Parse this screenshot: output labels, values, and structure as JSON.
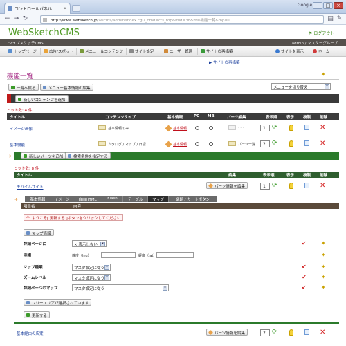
{
  "browser": {
    "tab_title": "コントロールパネル",
    "top_right_text": "Google",
    "url_prefix": "http://www.websketch.jp",
    "url_rest": "/wscms/admin/index.cgi?_cmd=cts_top&mid=38&m=機能一覧&mp=1"
  },
  "app": {
    "logo": "WebSketchCMS",
    "logout": "ログアウト",
    "site_name": "ウェブスケッチCMS",
    "user": "admin / マスターグループ"
  },
  "menu": {
    "items": [
      "トップページ",
      "広告/スポット",
      "メニュー＆コンテンツ",
      "サイト設定",
      "ユーザー管理",
      "サイトの再構築"
    ],
    "right": [
      "サイトを表示",
      "ホーム"
    ],
    "rebuild_link": "サイトの再構築"
  },
  "page": {
    "title": "機能一覧",
    "back_button": "一覧へ戻る",
    "edit_menu_button": "メニュー基本情報の編集",
    "menu_switch": "メニューを切り替え",
    "add_content_button": "新しいコンテンツを追加"
  },
  "table1": {
    "hits": "ヒット数: 4 件",
    "headers": [
      "タイトル",
      "コンテンツタイプ",
      "基本情報",
      "PC",
      "MB",
      "パーツ編集",
      "表示順",
      "表示",
      "複製",
      "削除"
    ],
    "rows": [
      {
        "title": "イメージ画像",
        "type": "基本情報のみ",
        "info": "基本情報",
        "parts": "",
        "order": "1"
      },
      {
        "title": "基本機能",
        "type": "カタログ / マップ / 日記",
        "info": "基本情報",
        "parts": "パーツ一覧",
        "order": "2"
      }
    ]
  },
  "table2": {
    "add_parts_button": "新しいパーツを追加",
    "search_button": "検索条件を指定する",
    "hits": "ヒット数: 8 件",
    "headers": [
      "タイトル",
      "編集",
      "表示順",
      "表示",
      "複製",
      "削除"
    ],
    "row": {
      "title": "モバイルサイト",
      "edit": "パーツ情報を編集",
      "order": "1"
    }
  },
  "editor": {
    "tabs": [
      "基本情報",
      "イメージ",
      "自由HTML",
      "Flash",
      "テーブル",
      "マップ",
      "議題 / カートボタン"
    ],
    "active_tab": "マップ",
    "col_headers": [
      "項目名",
      "内容"
    ],
    "notice": "ようこそ[ 更新する ]ボタンをクリックしてください",
    "map_info_button": "マップ情報",
    "fields": [
      {
        "label": "詳細ページに",
        "value": "× 表示しない"
      },
      {
        "label": "座標",
        "lat_label": "緯度（lng）",
        "lng_label": "経度（lat）"
      },
      {
        "label": "マップ種類",
        "value": "マスタ設定に従う"
      },
      {
        "label": "ズームレベル",
        "value": "マスタ設定に従う"
      },
      {
        "label": "詳細ページのマップ",
        "value": "マスタ設定に従う"
      }
    ],
    "free_area_button": "フリーエリアが選択されています",
    "update_button": "更新する"
  },
  "table3": {
    "row": {
      "title": "基本経由の店案",
      "edit": "パーツ情報を編集",
      "order": "2"
    }
  },
  "colors": {
    "logo_green": "#4f9a24",
    "title_purple": "#a0207e",
    "hit_red": "#c0101c",
    "bar_green": "#2b7a2b",
    "dark_bar": "#3a3a3a"
  }
}
